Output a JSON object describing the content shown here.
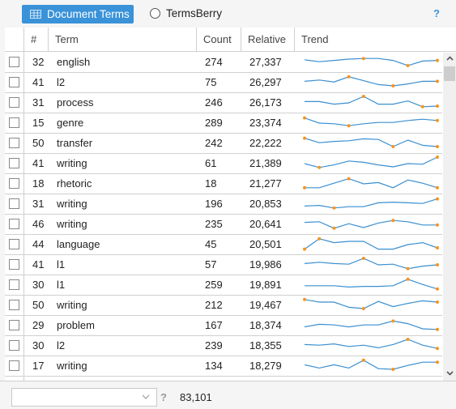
{
  "toolbar": {
    "document_terms_label": "Document Terms",
    "termsberry_label": "TermsBerry",
    "help_label": "?",
    "colors": {
      "accent": "#3a92d8"
    }
  },
  "table": {
    "columns": {
      "num": "#",
      "term": "Term",
      "count": "Count",
      "relative": "Relative",
      "trend": "Trend"
    },
    "rows": [
      {
        "num": "32",
        "term": "english",
        "count": "274",
        "relative": "27,337",
        "trend": [
          7,
          5.5,
          6.5,
          7.5,
          8,
          8,
          6.5,
          2.5,
          6,
          6.5
        ]
      },
      {
        "num": "41",
        "term": "l2",
        "count": "75",
        "relative": "26,297",
        "trend": [
          6,
          7,
          5.5,
          9.5,
          6.5,
          3.5,
          2.5,
          4,
          6,
          6
        ]
      },
      {
        "num": "31",
        "term": "process",
        "count": "246",
        "relative": "26,173",
        "trend": [
          6,
          6,
          4,
          5,
          10,
          4,
          4,
          6.5,
          2,
          2.5
        ]
      },
      {
        "num": "15",
        "term": "genre",
        "count": "289",
        "relative": "23,374",
        "trend": [
          9,
          5,
          4.5,
          3,
          4.5,
          5.5,
          5.5,
          7,
          8,
          7
        ]
      },
      {
        "num": "50",
        "term": "transfer",
        "count": "242",
        "relative": "22,222",
        "trend": [
          9,
          5.5,
          6.5,
          7,
          8.5,
          8,
          2.5,
          7.5,
          3.5,
          2.5
        ]
      },
      {
        "num": "41",
        "term": "writing",
        "count": "61",
        "relative": "21,389",
        "trend": [
          5,
          2,
          4,
          7,
          6,
          4,
          2.5,
          5,
          4.5,
          10
        ]
      },
      {
        "num": "18",
        "term": "rhetoric",
        "count": "18",
        "relative": "21,277",
        "trend": [
          2,
          2,
          5.5,
          9,
          5,
          6,
          2,
          8,
          5.5,
          2
        ]
      },
      {
        "num": "31",
        "term": "writing",
        "count": "196",
        "relative": "20,853",
        "trend": [
          3.5,
          4,
          2,
          3,
          3,
          6,
          6.5,
          6,
          5.5,
          9
        ]
      },
      {
        "num": "46",
        "term": "writing",
        "count": "235",
        "relative": "20,641",
        "trend": [
          6.5,
          7,
          2,
          5.5,
          2.5,
          6,
          8,
          7,
          4.5,
          4.5
        ]
      },
      {
        "num": "44",
        "term": "language",
        "count": "45",
        "relative": "20,501",
        "trend": [
          1.5,
          9.5,
          6.5,
          7.5,
          7.5,
          1.5,
          1.5,
          5,
          6.5,
          2.5
        ]
      },
      {
        "num": "41",
        "term": "l1",
        "count": "57",
        "relative": "19,986",
        "trend": [
          6,
          7,
          6,
          5.5,
          10,
          5,
          5.5,
          2,
          4,
          5
        ]
      },
      {
        "num": "30",
        "term": "l1",
        "count": "259",
        "relative": "19,891",
        "trend": [
          4.5,
          4.5,
          4.5,
          3.5,
          4,
          4,
          4.5,
          9.5,
          5.5,
          2
        ]
      },
      {
        "num": "50",
        "term": "writing",
        "count": "212",
        "relative": "19,467",
        "trend": [
          9.5,
          7.5,
          7.5,
          3.5,
          2.5,
          8,
          4,
          6.5,
          8.5,
          7.5
        ]
      },
      {
        "num": "29",
        "term": "problem",
        "count": "167",
        "relative": "18,374",
        "trend": [
          4,
          6,
          5.5,
          4,
          5.5,
          5.5,
          8.5,
          6.5,
          2.5,
          2
        ]
      },
      {
        "num": "30",
        "term": "l2",
        "count": "239",
        "relative": "18,355",
        "trend": [
          6,
          5.5,
          6.5,
          4.5,
          5.5,
          3.5,
          6,
          10,
          5.5,
          3
        ]
      },
      {
        "num": "17",
        "term": "writing",
        "count": "134",
        "relative": "18,279",
        "trend": [
          6,
          3.5,
          6,
          3.5,
          9.5,
          3,
          2.5,
          5.5,
          8,
          8
        ]
      }
    ]
  },
  "footer": {
    "select_value": "",
    "help_label": "?",
    "total": "83,101"
  },
  "icons": {
    "grid": "table-grid-icon",
    "radio": "radio-unchecked-icon",
    "scroll_up": "chevron-up-icon",
    "scroll_down": "chevron-down-icon",
    "select_chevron": "chevron-down-icon"
  },
  "sparkline_colors": {
    "line": "#3a8fd0",
    "marker": "#f7941d"
  }
}
